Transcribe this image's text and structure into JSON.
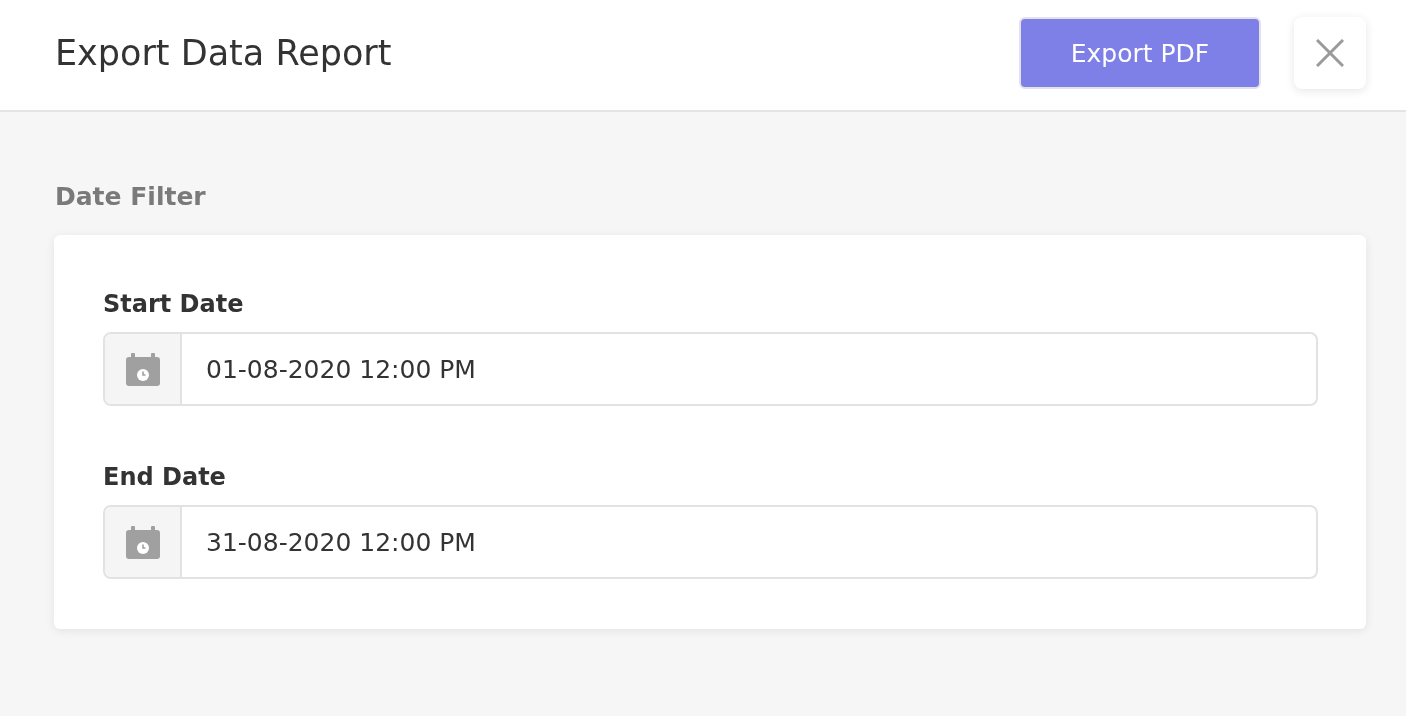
{
  "header": {
    "title": "Export Data Report",
    "export_button": "Export PDF"
  },
  "date_filter": {
    "heading": "Date Filter",
    "fields": [
      {
        "label": "Start Date",
        "value": "01-08-2020 12:00 PM"
      },
      {
        "label": "End Date",
        "value": "31-08-2020 12:00 PM"
      }
    ]
  }
}
